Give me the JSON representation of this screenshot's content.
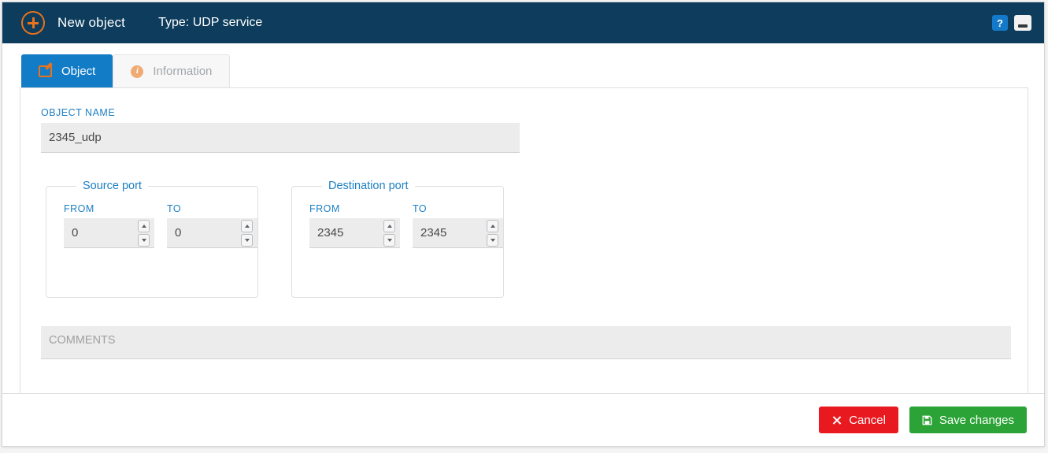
{
  "titlebar": {
    "add_icon": "plus-circle-icon",
    "title": "New object",
    "type_text": "Type: UDP service",
    "help_label": "?",
    "help_icon": "help-icon",
    "minimize_icon": "minimize-icon"
  },
  "tabs": [
    {
      "label": "Object",
      "icon": "edit-icon",
      "active": true
    },
    {
      "label": "Information",
      "icon": "info-icon",
      "active": false
    }
  ],
  "form": {
    "object_name": {
      "label": "OBJECT NAME",
      "value": "2345_udp",
      "placeholder": ""
    },
    "source_port": {
      "legend": "Source port",
      "from": {
        "label": "FROM",
        "value": "0"
      },
      "to": {
        "label": "TO",
        "value": "0"
      }
    },
    "destination_port": {
      "legend": "Destination port",
      "from": {
        "label": "FROM",
        "value": "2345"
      },
      "to": {
        "label": "TO",
        "value": "2345"
      }
    },
    "comments": {
      "placeholder": "COMMENTS",
      "value": ""
    }
  },
  "footer": {
    "cancel_label": "Cancel",
    "cancel_icon": "close-x-icon",
    "save_label": "Save changes",
    "save_icon": "floppy-save-icon"
  },
  "colors": {
    "header_bg": "#0d3c5c",
    "accent_orange": "#e8731c",
    "accent_blue": "#127cc7",
    "label_blue": "#1c7fc4",
    "cancel_red": "#e8191f",
    "save_green": "#2ba336",
    "input_bg": "#ececec"
  }
}
